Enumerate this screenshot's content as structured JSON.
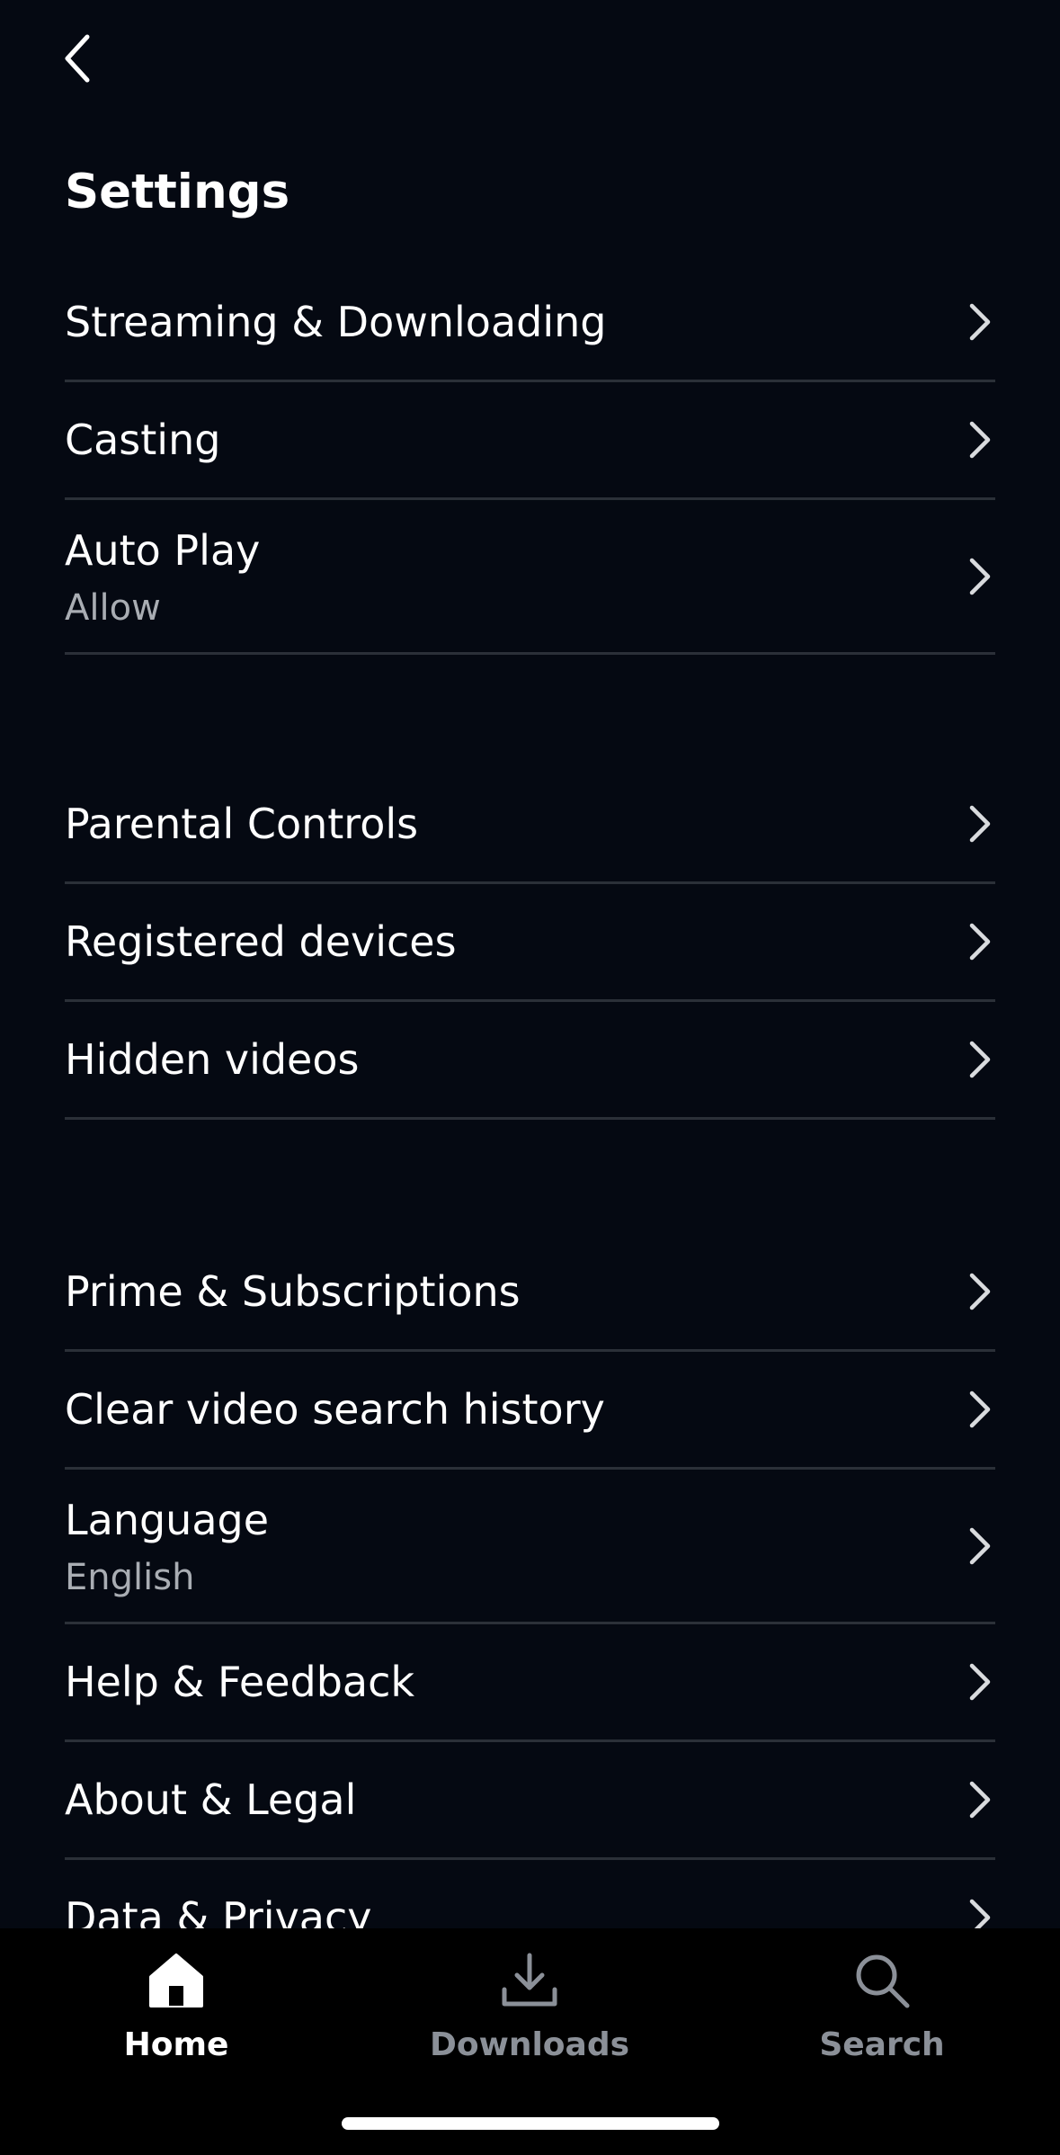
{
  "header": {
    "back_icon": "chevron-left-icon",
    "title": "Settings"
  },
  "groups": [
    {
      "items": [
        {
          "label": "Streaming & Downloading",
          "sub": ""
        },
        {
          "label": "Casting",
          "sub": ""
        },
        {
          "label": "Auto Play",
          "sub": "Allow"
        }
      ]
    },
    {
      "items": [
        {
          "label": "Parental Controls",
          "sub": ""
        },
        {
          "label": "Registered devices",
          "sub": ""
        },
        {
          "label": "Hidden videos",
          "sub": ""
        }
      ]
    },
    {
      "items": [
        {
          "label": "Prime & Subscriptions",
          "sub": ""
        },
        {
          "label": "Clear video search history",
          "sub": ""
        },
        {
          "label": "Language",
          "sub": "English"
        },
        {
          "label": "Help & Feedback",
          "sub": ""
        },
        {
          "label": "About & Legal",
          "sub": ""
        },
        {
          "label": "Data & Privacy",
          "sub": ""
        }
      ]
    }
  ],
  "bottom_nav": {
    "items": [
      {
        "label": "Home",
        "icon": "home-icon",
        "active": true
      },
      {
        "label": "Downloads",
        "icon": "download-icon",
        "active": false
      },
      {
        "label": "Search",
        "icon": "search-icon",
        "active": false
      }
    ]
  },
  "colors": {
    "background": "#050912",
    "divider": "#2b3038",
    "subtext": "#a9adb3",
    "nav_background": "#000000",
    "nav_inactive": "#8b9098"
  }
}
